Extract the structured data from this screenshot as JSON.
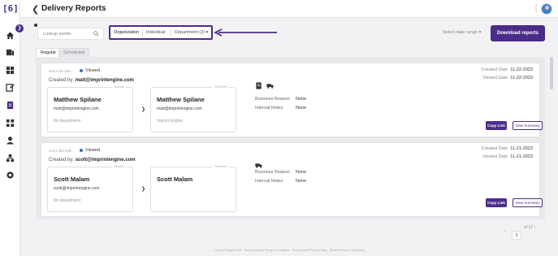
{
  "brand": {
    "logo_text": "[6]",
    "accent": "#4b2c8a"
  },
  "sidebar": {
    "badge": "❯",
    "items": [
      {
        "name": "home-icon"
      },
      {
        "name": "inventory-icon"
      },
      {
        "name": "dashboard-icon"
      },
      {
        "name": "edit-icon"
      },
      {
        "name": "reports-icon"
      },
      {
        "name": "apps-icon"
      },
      {
        "name": "user-icon"
      },
      {
        "name": "org-icon"
      },
      {
        "name": "settings-icon"
      }
    ]
  },
  "header": {
    "title": "Delivery Reports",
    "back_icon": "chevron-left-icon",
    "menu_icon": "kebab-icon"
  },
  "toolbar": {
    "search_placeholder": "Lookup sends",
    "filters": [
      "Organization",
      "Individual",
      "Department (2) ▾"
    ],
    "date_range": "Select date range ▾",
    "download_label": "Download reports"
  },
  "tabs": [
    "Regular",
    "Scheduled"
  ],
  "reports": [
    {
      "id": "send-4hk-tdm",
      "status": "Viewed",
      "created_by_label": "Created by:",
      "created_by": "matt@imprintengine.com",
      "sender": {
        "role": "Sender",
        "name": "Matthew Spilane",
        "email": "matt@imprintengine.com",
        "dept": "No department"
      },
      "receiver": {
        "role": "Receiver",
        "name": "Matthew Spilane",
        "email": "matt@imprintengine.com",
        "dept": "Imprint Engine"
      },
      "business_reason_label": "Business Reason",
      "business_reason": "None",
      "internal_notes_label": "Internal Notes",
      "internal_notes": "None",
      "created_date_label": "Created Date",
      "created_date": "11-22-2023",
      "viewed_date_label": "Viewed Date",
      "viewed_date": "11-22-2023",
      "copy_label": "Copy Link",
      "summary_label": "View Summary"
    },
    {
      "id": "send-dbd-wdb",
      "status": "Viewed",
      "created_by_label": "Created by:",
      "created_by": "scott@imprintengine.com",
      "sender": {
        "role": "Sender",
        "name": "Scott Malam",
        "email": "scott@imprintengine.com",
        "dept": "No department"
      },
      "receiver": {
        "role": "Receiver",
        "name": "Scott Malam",
        "email": "",
        "dept": ""
      },
      "business_reason_label": "Business Reason",
      "business_reason": "None",
      "internal_notes_label": "Internal Notes",
      "internal_notes": "None",
      "created_date_label": "Created Date",
      "created_date": "11-21-2023",
      "viewed_date_label": "Viewed Date",
      "viewed_date": "11-21-2023",
      "copy_label": "Copy Link",
      "summary_label": "View Summary"
    }
  ],
  "pagination": {
    "of_label": "of 17 ›",
    "current": "1",
    "prev": "‹",
    "next": "›"
  },
  "footer": "© Imprint Engine 2023 · General Supply Terms & Conditions · General Data Privacy Policy · Student Terms & Conditions"
}
